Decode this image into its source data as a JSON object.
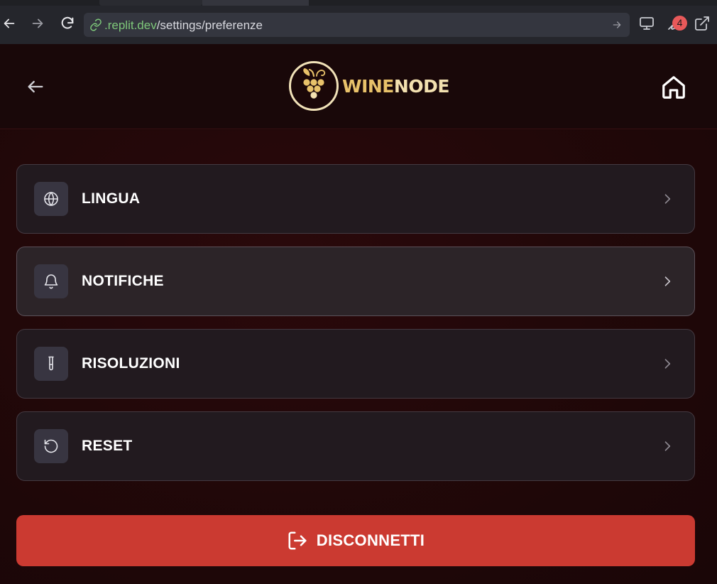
{
  "browser": {
    "url_host": ".replit.dev",
    "url_path": "/settings/preferenze",
    "notification_count": "4"
  },
  "header": {
    "logo_word_1": "WINE",
    "logo_word_2": "NODE"
  },
  "menu": {
    "items": [
      {
        "label": "LINGUA",
        "icon": "globe-icon"
      },
      {
        "label": "NOTIFICHE",
        "icon": "bell-icon"
      },
      {
        "label": "RISOLUZIONI",
        "icon": "test-tube-icon"
      },
      {
        "label": "RESET",
        "icon": "rotate-ccw-icon"
      }
    ]
  },
  "logout": {
    "label": "DISCONNETTI",
    "icon": "log-out-icon"
  },
  "colors": {
    "accent_red": "#cb3a31",
    "gold": "#e8c26a",
    "background": "#1a0708"
  }
}
